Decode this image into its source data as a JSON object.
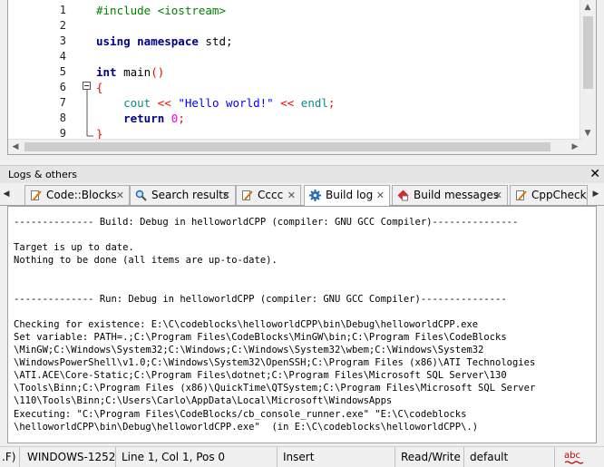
{
  "editor": {
    "lines": [
      {
        "n": "1",
        "segments": [
          {
            "c": "pp",
            "t": "#include <iostream>"
          }
        ]
      },
      {
        "n": "2",
        "segments": []
      },
      {
        "n": "3",
        "segments": [
          {
            "c": "kw",
            "t": "using namespace "
          },
          {
            "c": "",
            "t": "std;"
          }
        ]
      },
      {
        "n": "4",
        "segments": []
      },
      {
        "n": "5",
        "segments": [
          {
            "c": "kw",
            "t": "int "
          },
          {
            "c": "",
            "t": "main"
          },
          {
            "c": "op",
            "t": "()"
          }
        ]
      },
      {
        "n": "6",
        "segments": [
          {
            "c": "op",
            "t": "{"
          }
        ]
      },
      {
        "n": "7",
        "segments": [
          {
            "c": "",
            "t": "    "
          },
          {
            "c": "cyan",
            "t": "cout "
          },
          {
            "c": "op",
            "t": "<< "
          },
          {
            "c": "str",
            "t": "\"Hello world!\" "
          },
          {
            "c": "op",
            "t": "<< "
          },
          {
            "c": "cyan",
            "t": "endl"
          },
          {
            "c": "op",
            "t": ";"
          }
        ]
      },
      {
        "n": "8",
        "segments": [
          {
            "c": "",
            "t": "    "
          },
          {
            "c": "kw",
            "t": "return "
          },
          {
            "c": "num",
            "t": "0"
          },
          {
            "c": "op",
            "t": ";"
          }
        ]
      },
      {
        "n": "9",
        "segments": [
          {
            "c": "op",
            "t": "}"
          }
        ]
      }
    ]
  },
  "logs_panel": {
    "title": "Logs & others",
    "close_glyph": "✕",
    "tabs": [
      {
        "label": "Code::Blocks",
        "icon": "document-pencil-icon",
        "active": false
      },
      {
        "label": "Search results",
        "icon": "magnifier-icon",
        "active": false
      },
      {
        "label": "Cccc",
        "icon": "document-pencil-icon",
        "active": false
      },
      {
        "label": "Build log",
        "icon": "gear-icon",
        "active": true
      },
      {
        "label": "Build messages",
        "icon": "red-diamond-icon",
        "active": false
      },
      {
        "label": "CppCheck/V",
        "icon": "document-pencil-icon",
        "active": false
      }
    ],
    "log_lines": [
      "-------------- Build: Debug in helloworldCPP (compiler: GNU GCC Compiler)---------------",
      "",
      "Target is up to date.",
      "Nothing to be done (all items are up-to-date).",
      "",
      "",
      "-------------- Run: Debug in helloworldCPP (compiler: GNU GCC Compiler)---------------",
      "",
      "Checking for existence: E:\\C\\codeblocks\\helloworldCPP\\bin\\Debug\\helloworldCPP.exe",
      "Set variable: PATH=.;C:\\Program Files\\CodeBlocks\\MinGW\\bin;C:\\Program Files\\CodeBlocks",
      "\\MinGW;C:\\Windows\\System32;C:\\Windows;C:\\Windows\\System32\\wbem;C:\\Windows\\System32",
      "\\WindowsPowerShell\\v1.0;C:\\Windows\\System32\\OpenSSH;C:\\Program Files (x86)\\ATI Technologies",
      "\\ATI.ACE\\Core-Static;C:\\Program Files\\dotnet;C:\\Program Files\\Microsoft SQL Server\\130",
      "\\Tools\\Binn;C:\\Program Files (x86)\\QuickTime\\QTSystem;C:\\Program Files\\Microsoft SQL Server",
      "\\110\\Tools\\Binn;C:\\Users\\Carlo\\AppData\\Local\\Microsoft\\WindowsApps",
      "Executing: \"C:\\Program Files\\CodeBlocks/cb_console_runner.exe\" \"E:\\C\\codeblocks",
      "\\helloworldCPP\\bin\\Debug\\helloworldCPP.exe\"  (in E:\\C\\codeblocks\\helloworldCPP\\.)"
    ]
  },
  "statusbar": {
    "eol": ".F)",
    "encoding": "WINDOWS-1252",
    "position": "Line 1, Col 1, Pos 0",
    "mode": "Insert",
    "access": "Read/Write",
    "lang": "default",
    "spell": "abc"
  }
}
